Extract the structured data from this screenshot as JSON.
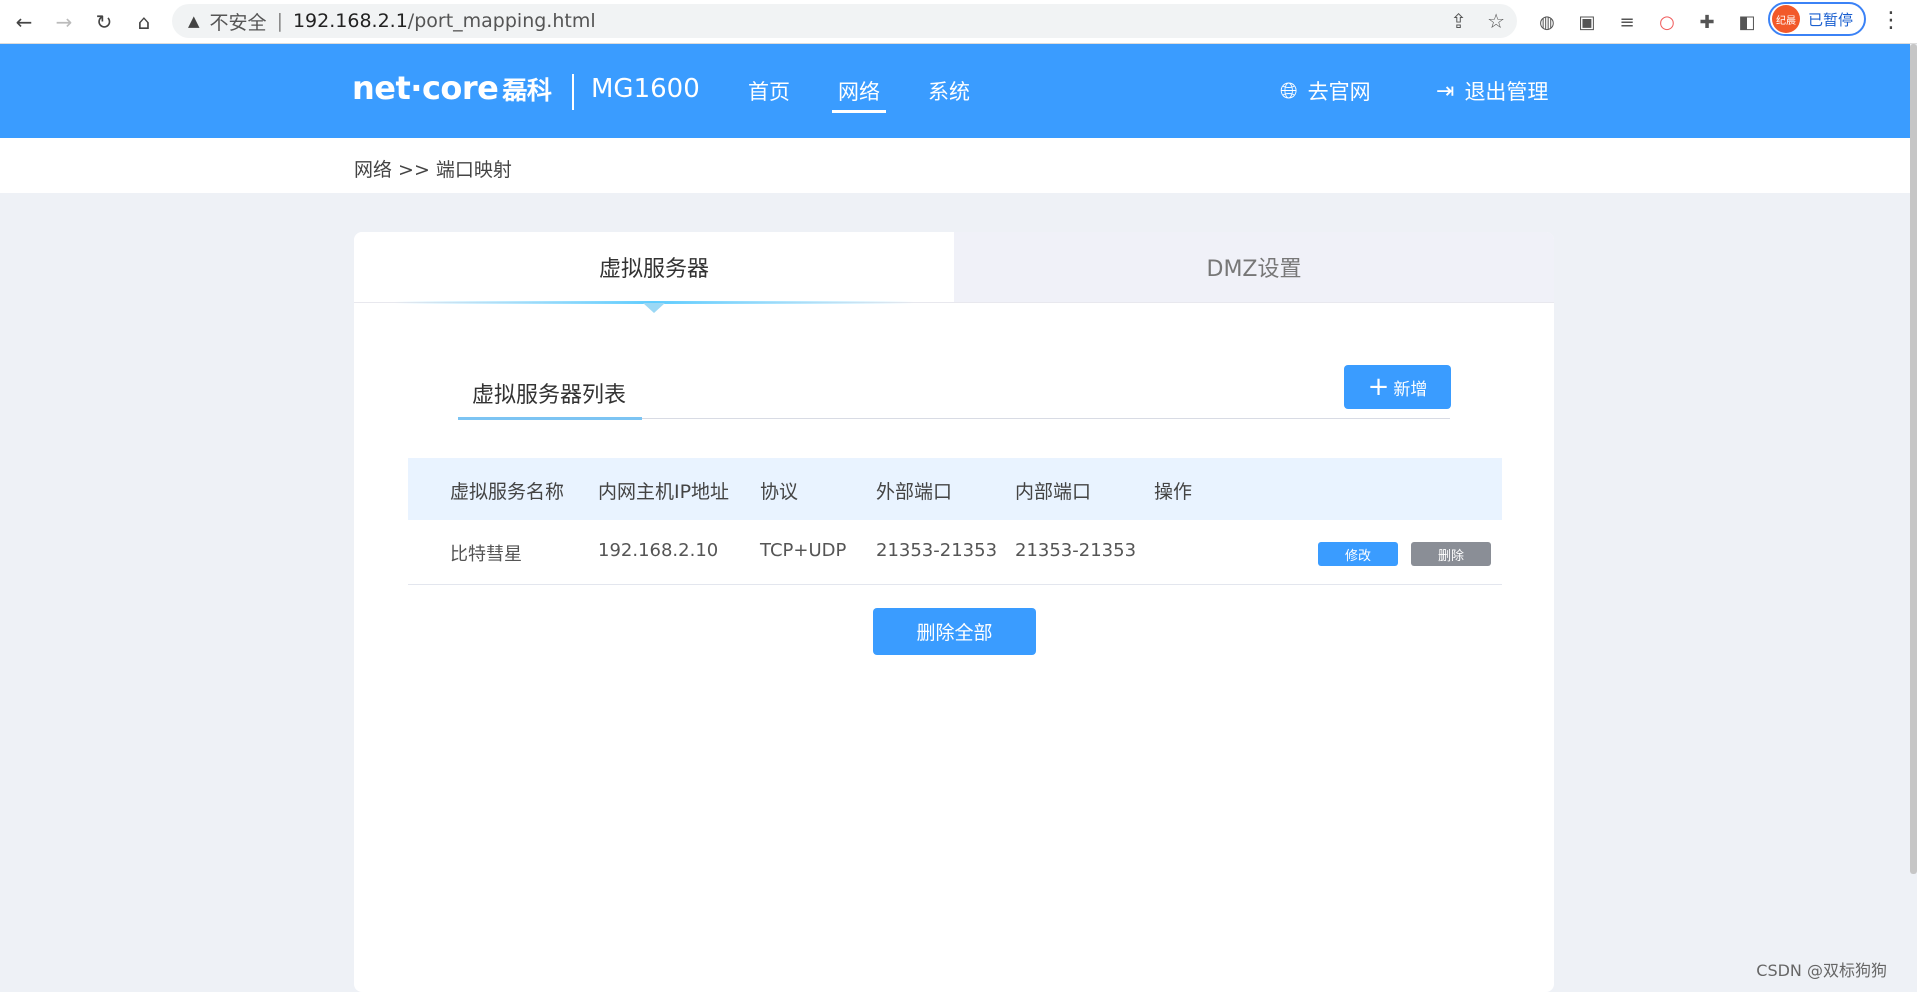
{
  "browser": {
    "url_host": "192.168.2.1",
    "url_path": "/port_mapping.html",
    "security_label": "不安全",
    "profile_avatar_text": "纪晨",
    "profile_label": "已暂停"
  },
  "header": {
    "logo": "net·core",
    "logo_cn": "磊科",
    "model": "MG1600",
    "menu": [
      "首页",
      "网络",
      "系统"
    ],
    "active_menu": "网络",
    "link_site": "去官网",
    "link_logout": "退出管理",
    "bg_color": "#3a9cff"
  },
  "breadcrumb": "网络 >> 端口映射",
  "tabs": [
    "虚拟服务器",
    "DMZ设置"
  ],
  "active_tab": "虚拟服务器",
  "list": {
    "title": "虚拟服务器列表",
    "add_label": "新增",
    "columns": [
      "虚拟服务名称",
      "内网主机IP地址",
      "协议",
      "外部端口",
      "内部端口",
      "操作"
    ],
    "rows": [
      {
        "name": "比特彗星",
        "ip": "192.168.2.10",
        "protocol": "TCP+UDP",
        "external_port": "21353-21353",
        "internal_port": "21353-21353",
        "edit_label": "修改",
        "delete_label": "删除"
      }
    ],
    "delete_all_label": "删除全部"
  },
  "watermark": "CSDN @双标狗狗"
}
